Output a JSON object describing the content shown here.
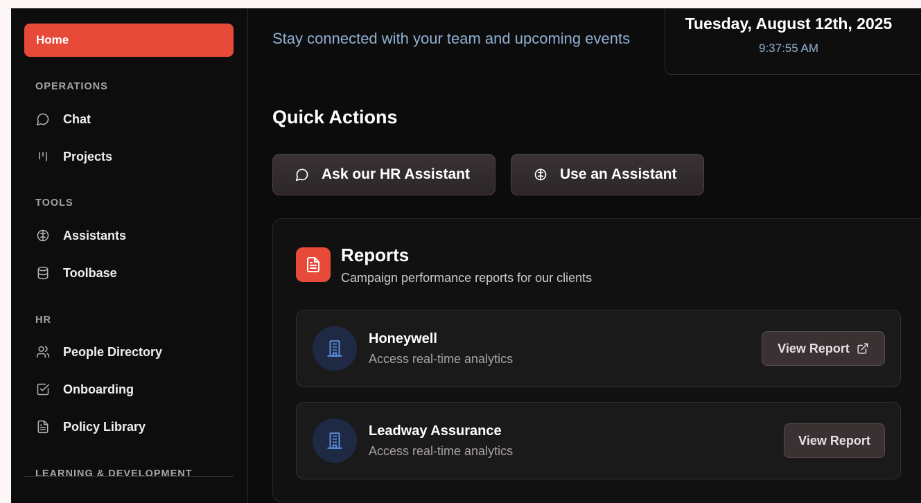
{
  "sidebar": {
    "home_label": "Home",
    "sections": {
      "operations": "OPERATIONS",
      "tools": "TOOLS",
      "hr": "HR",
      "learning": "LEARNING & DEVELOPMENT"
    },
    "items": [
      {
        "label": "Chat",
        "icon": "chat-bubble-icon"
      },
      {
        "label": "Projects",
        "icon": "kanban-icon"
      },
      {
        "label": "Assistants",
        "icon": "brain-icon"
      },
      {
        "label": "Toolbase",
        "icon": "database-icon"
      },
      {
        "label": "People Directory",
        "icon": "users-icon"
      },
      {
        "label": "Onboarding",
        "icon": "checkbox-icon"
      },
      {
        "label": "Policy Library",
        "icon": "document-icon"
      }
    ]
  },
  "header": {
    "subtitle": "Stay connected with your team and upcoming events",
    "date": "Tuesday, August 12th, 2025",
    "time": "9:37:55 AM"
  },
  "quick_actions": {
    "title": "Quick Actions",
    "buttons": [
      {
        "label": "Ask our HR Assistant",
        "icon": "chat-bubble-icon"
      },
      {
        "label": "Use an Assistant",
        "icon": "brain-icon"
      }
    ]
  },
  "reports": {
    "title": "Reports",
    "description": "Campaign performance reports for our clients",
    "icon": "document-icon",
    "items": [
      {
        "name": "Honeywell",
        "description": "Access real-time analytics",
        "button": "View Report",
        "icon": "building-icon"
      },
      {
        "name": "Leadway Assurance",
        "description": "Access real-time analytics",
        "button": "View Report",
        "icon": "building-icon"
      }
    ]
  },
  "colors": {
    "accent": "#e84a3a",
    "background": "#0d0c0d",
    "muted_blue": "#8fb0d2",
    "avatar_bg": "#1e2a44"
  }
}
